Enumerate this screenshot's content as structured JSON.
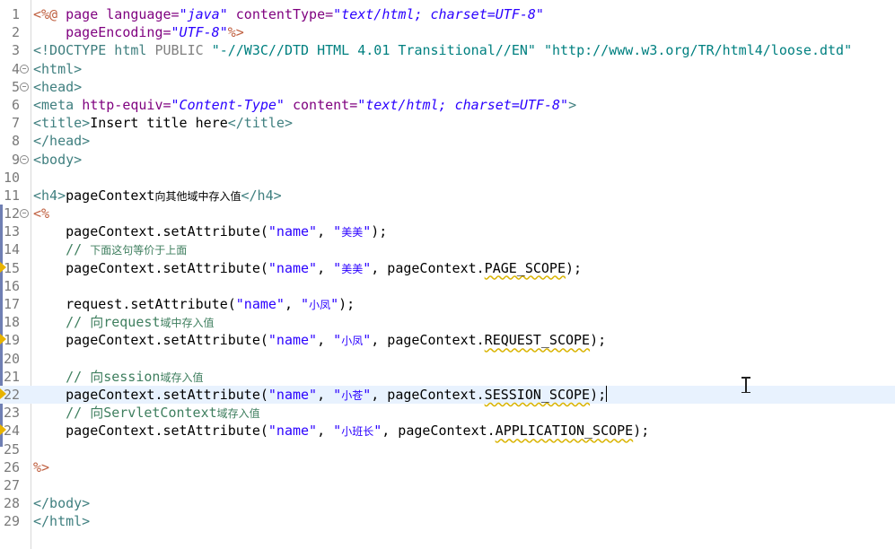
{
  "editor": {
    "lines": [
      {
        "n": "1",
        "fold": false,
        "marker": false
      },
      {
        "n": "2",
        "fold": false,
        "marker": false
      },
      {
        "n": "3",
        "fold": false,
        "marker": false
      },
      {
        "n": "4",
        "fold": true,
        "marker": false
      },
      {
        "n": "5",
        "fold": true,
        "marker": false
      },
      {
        "n": "6",
        "fold": false,
        "marker": false
      },
      {
        "n": "7",
        "fold": false,
        "marker": false
      },
      {
        "n": "8",
        "fold": false,
        "marker": false
      },
      {
        "n": "9",
        "fold": true,
        "marker": false
      },
      {
        "n": "10",
        "fold": false,
        "marker": false
      },
      {
        "n": "11",
        "fold": false,
        "marker": false
      },
      {
        "n": "12",
        "fold": true,
        "marker": false
      },
      {
        "n": "13",
        "fold": false,
        "marker": false
      },
      {
        "n": "14",
        "fold": false,
        "marker": false
      },
      {
        "n": "15",
        "fold": false,
        "marker": true
      },
      {
        "n": "16",
        "fold": false,
        "marker": false
      },
      {
        "n": "17",
        "fold": false,
        "marker": false
      },
      {
        "n": "18",
        "fold": false,
        "marker": false
      },
      {
        "n": "19",
        "fold": false,
        "marker": true
      },
      {
        "n": "20",
        "fold": false,
        "marker": false
      },
      {
        "n": "21",
        "fold": false,
        "marker": false
      },
      {
        "n": "22",
        "fold": false,
        "marker": true
      },
      {
        "n": "23",
        "fold": false,
        "marker": false
      },
      {
        "n": "24",
        "fold": false,
        "marker": true
      },
      {
        "n": "25",
        "fold": false,
        "marker": false
      },
      {
        "n": "26",
        "fold": false,
        "marker": false
      },
      {
        "n": "27",
        "fold": false,
        "marker": false
      },
      {
        "n": "28",
        "fold": false,
        "marker": false
      },
      {
        "n": "29",
        "fold": false,
        "marker": false
      }
    ],
    "current_line": "22",
    "tokens": {
      "l1_a": "<%@ ",
      "l1_b": "page ",
      "l1_c": "language=",
      "l1_d": "\"java\"",
      "l1_e": " contentType=",
      "l1_f": "\"text/html; charset=UTF-8\"",
      "l2_a": "    pageEncoding=",
      "l2_b": "\"UTF-8\"",
      "l2_c": "%>",
      "l3_a": "<!DOCTYPE html ",
      "l3_b": "PUBLIC ",
      "l3_c": "\"-//W3C//DTD HTML 4.01 Transitional//EN\" \"http://www.w3.org/TR/html4/loose.dtd\"",
      "l4": "<html>",
      "l5": "<head>",
      "l6_a": "<meta ",
      "l6_b": "http-equiv=",
      "l6_c": "\"Content-Type\"",
      "l6_d": " content=",
      "l6_e": "\"text/html; charset=UTF-8\"",
      "l6_f": ">",
      "l7_a": "<title>",
      "l7_b": "Insert title here",
      "l7_c": "</title>",
      "l8": "</head>",
      "l9": "<body>",
      "l11_a": "<h4>",
      "l11_b": "pageContext",
      "l11_c": "向其他域中存入值",
      "l11_d": "</h4>",
      "l12": "<%",
      "l13_a": "    pageContext.setAttribute(",
      "l13_b": "\"name\"",
      "l13_c": ", ",
      "l13_d": "\"",
      "l13_e": "美美",
      "l13_f": "\"",
      "l13_g": ");",
      "l14_a": "    // ",
      "l14_b": "下面这句等价于上面",
      "l15_a": "    pageContext.setAttribute(",
      "l15_b": "\"name\"",
      "l15_c": ", ",
      "l15_d": "\"",
      "l15_e": "美美",
      "l15_f": "\"",
      "l15_g": ", pageContext.",
      "l15_h": "PAGE_SCOPE",
      "l15_i": ");",
      "l17_a": "    request.setAttribute(",
      "l17_b": "\"name\"",
      "l17_c": ", ",
      "l17_d": "\"",
      "l17_e": "小凤",
      "l17_f": "\"",
      "l17_g": ");",
      "l18_a": "    // ",
      "l18_b": "向request",
      "l18_c": "域中存入值",
      "l19_a": "    pageContext.setAttribute(",
      "l19_b": "\"name\"",
      "l19_c": ", ",
      "l19_d": "\"",
      "l19_e": "小凤",
      "l19_f": "\"",
      "l19_g": ", pageContext.",
      "l19_h": "REQUEST_SCOPE",
      "l19_i": ");",
      "l21_a": "    // ",
      "l21_b": "向session",
      "l21_c": "域存入值",
      "l22_a": "    pageContext.setAttribute(",
      "l22_b": "\"name\"",
      "l22_c": ", ",
      "l22_d": "\"",
      "l22_e": "小苍",
      "l22_f": "\"",
      "l22_g": ", pageContext.",
      "l22_h": "SESSION_SCOPE",
      "l22_i": ");",
      "l23_a": "    // ",
      "l23_b": "向ServletContext",
      "l23_c": "域存入值",
      "l24_a": "    pageContext.setAttribute(",
      "l24_b": "\"name\"",
      "l24_c": ", ",
      "l24_d": "\"",
      "l24_e": "小班长",
      "l24_f": "\"",
      "l24_g": ", pageContext.",
      "l24_h": "APPLICATION_SCOPE",
      "l24_i": ");",
      "l26": "%>",
      "l28": "</body>",
      "l29": "</html>"
    }
  },
  "colors": {
    "tag": "#3f7f7f",
    "attribute": "#7f007f",
    "string": "#2a00ff",
    "directive": "#bf5f3f",
    "comment": "#3f7f5f",
    "current_line_bg": "#e8f2fe",
    "warning_marker": "#e8b300"
  },
  "icons": {
    "fold": "fold-toggle-icon",
    "warning": "warning-marker-icon",
    "cursor": "text-cursor-icon"
  }
}
